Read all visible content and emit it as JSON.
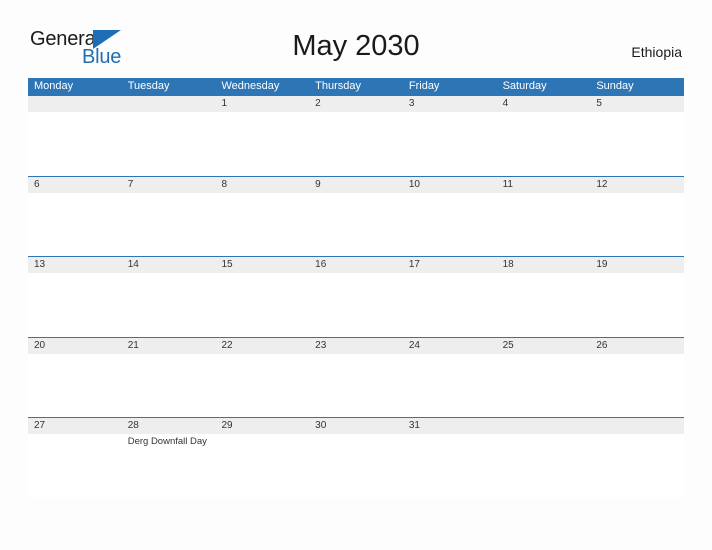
{
  "header": {
    "logo": {
      "word_one": "General",
      "word_two": "Blue",
      "triangle_color": "#1f6eb5"
    },
    "title": "May 2030",
    "country": "Ethiopia"
  },
  "theme": {
    "header_blue": "#2e75b6",
    "band_gray": "#eeeeee",
    "page_background": "#fdfdfd",
    "text_dark": "#333333"
  },
  "calendar": {
    "weekdays": [
      "Monday",
      "Tuesday",
      "Wednesday",
      "Thursday",
      "Friday",
      "Saturday",
      "Sunday"
    ],
    "weeks": [
      [
        {
          "day": ""
        },
        {
          "day": ""
        },
        {
          "day": "1"
        },
        {
          "day": "2"
        },
        {
          "day": "3"
        },
        {
          "day": "4"
        },
        {
          "day": "5"
        }
      ],
      [
        {
          "day": "6"
        },
        {
          "day": "7"
        },
        {
          "day": "8"
        },
        {
          "day": "9"
        },
        {
          "day": "10"
        },
        {
          "day": "11"
        },
        {
          "day": "12"
        }
      ],
      [
        {
          "day": "13"
        },
        {
          "day": "14"
        },
        {
          "day": "15"
        },
        {
          "day": "16"
        },
        {
          "day": "17"
        },
        {
          "day": "18"
        },
        {
          "day": "19"
        }
      ],
      [
        {
          "day": "20"
        },
        {
          "day": "21"
        },
        {
          "day": "22"
        },
        {
          "day": "23"
        },
        {
          "day": "24"
        },
        {
          "day": "25"
        },
        {
          "day": "26"
        }
      ],
      [
        {
          "day": "27"
        },
        {
          "day": "28",
          "event": "Derg Downfall Day"
        },
        {
          "day": "29"
        },
        {
          "day": "30"
        },
        {
          "day": "31"
        },
        {
          "day": ""
        },
        {
          "day": ""
        }
      ]
    ]
  }
}
